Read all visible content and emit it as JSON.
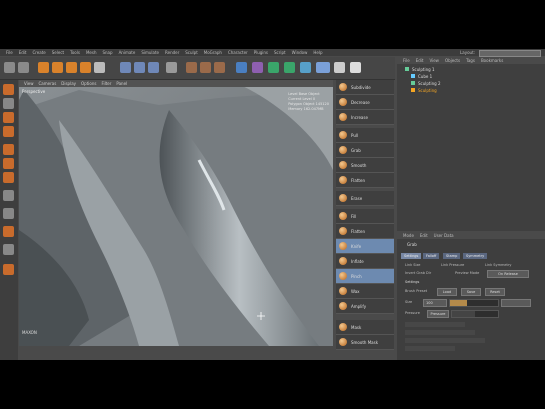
{
  "menubar": {
    "items": [
      "File",
      "Edit",
      "Create",
      "Select",
      "Tools",
      "Mesh",
      "Snap",
      "Animate",
      "Simulate",
      "Render",
      "Sculpt",
      "MoGraph",
      "Character",
      "Plugins",
      "Script",
      "Window",
      "Help"
    ],
    "layout_label": "Layout:"
  },
  "viewport": {
    "menu": [
      "View",
      "Cameras",
      "Display",
      "Options",
      "Filter",
      "Panel"
    ],
    "camera_label": "Perspective",
    "hud": {
      "level_label": "Level",
      "level_value": "Base Object",
      "current_label": "Current Level",
      "current_value": "0",
      "polygon_label": "Polygon Object",
      "polygon_value": "145120",
      "memory_label": "Memory",
      "memory_value": "162.047MB"
    },
    "axis_label": "MAXON"
  },
  "brushes": [
    {
      "label": "Subdivide"
    },
    {
      "label": "Decrease"
    },
    {
      "label": "Increase"
    },
    {
      "label": "Pull"
    },
    {
      "label": "Grab"
    },
    {
      "label": "Smooth"
    },
    {
      "label": "Flatten"
    },
    {
      "label": "Erase"
    },
    {
      "label": "Fill"
    },
    {
      "label": "Flatten"
    },
    {
      "label": "Knife"
    },
    {
      "label": "Inflate"
    },
    {
      "label": "Pinch"
    },
    {
      "label": "Wax"
    },
    {
      "label": "Amplify"
    },
    {
      "label": "Mask"
    },
    {
      "label": "Smooth Mask"
    }
  ],
  "objmgr": {
    "menu": [
      "File",
      "Edit",
      "View",
      "Objects",
      "Tags",
      "Bookmarks"
    ],
    "rows": [
      {
        "label": "Sculpting 1"
      },
      {
        "label": "Cube 1"
      },
      {
        "label": "Sculpting 2"
      },
      {
        "label": "Sculpting"
      }
    ]
  },
  "attr": {
    "menu": [
      "Mode",
      "Edit",
      "User Data"
    ],
    "title": "Grab",
    "tabs": [
      "Settings",
      "Falloff",
      "Stamp",
      "Symmetry"
    ],
    "link_size_label": "Link Size",
    "link_pressure_label": "Link Pressure",
    "link_symmetry_label": "Link Symmetry",
    "invert_label": "Invert Grab Dir",
    "preview_label": "Preview Mode",
    "preview_value": "On Release",
    "settings_label": "Settings",
    "brush_preset_label": "Brush Preset",
    "load_label": "Load",
    "save_label": "Save",
    "reset_label": "Reset",
    "size_label": "Size",
    "size_value": "100",
    "pressure_label": "Pressure",
    "pressure_value": "100",
    "pressure_mode": "Pressure"
  },
  "colors": {
    "accent": "#7888a5",
    "active_brush": "#6d8ab0"
  }
}
